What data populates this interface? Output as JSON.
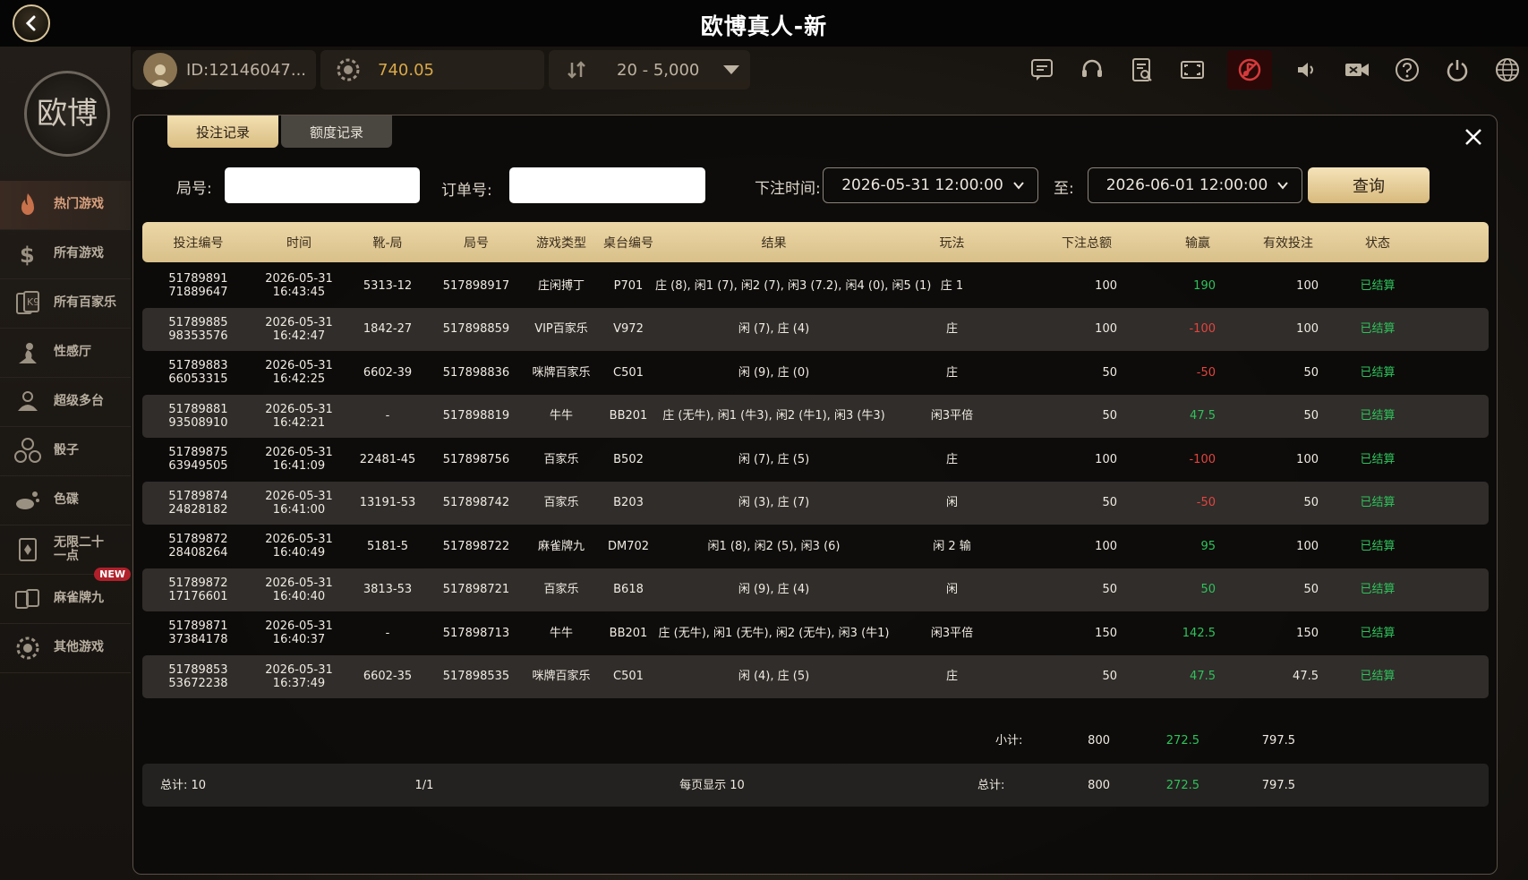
{
  "title": "欧博真人-新",
  "toolbar": {
    "user_id": "ID:12146047...",
    "balance": "740.05",
    "bet_range": "20 - 5,000",
    "icons": [
      "chat-icon",
      "support-icon",
      "history-icon",
      "fullscreen-icon",
      "music-icon",
      "sound-icon",
      "video-icon",
      "help-icon",
      "power-icon",
      "language-icon"
    ]
  },
  "sidebar": {
    "logo_text": "欧博",
    "items": [
      {
        "label": "热门游戏",
        "icon": "flame-icon",
        "active": true
      },
      {
        "label": "所有游戏",
        "icon": "dollar-icon"
      },
      {
        "label": "所有百家乐",
        "icon": "playing-card-icon"
      },
      {
        "label": "性感厅",
        "icon": "lady-icon"
      },
      {
        "label": "超级多台",
        "icon": "multi-table-icon"
      },
      {
        "label": "骰子",
        "icon": "dice-icon"
      },
      {
        "label": "色碟",
        "icon": "dish-icon"
      },
      {
        "label": "无限二十一点",
        "icon": "blackjack-icon"
      },
      {
        "label": "麻雀牌九",
        "icon": "mahjong-icon",
        "badge": "NEW"
      },
      {
        "label": "其他游戏",
        "icon": "chip-icon"
      }
    ]
  },
  "modal": {
    "tabs": [
      "投注记录",
      "额度记录"
    ],
    "filters": {
      "round_label": "局号:",
      "order_label": "订单号:",
      "time_label": "下注时间:",
      "start": "2026-05-31 12:00:00",
      "to_label": "至:",
      "end": "2026-06-01 12:00:00",
      "query_label": "查询"
    },
    "headers": [
      "投注编号",
      "时间",
      "靴-局",
      "局号",
      "游戏类型",
      "桌台编号",
      "结果",
      "玩法",
      "下注总额",
      "输赢",
      "有效投注",
      "状态"
    ],
    "rows": [
      {
        "id1": "51789891",
        "id2": "71889647",
        "date": "2026-05-31",
        "time": "16:43:45",
        "shoe": "5313-12",
        "round": "517898917",
        "type": "庄闲搏丁",
        "table": "P701",
        "result": "庄 (8), 闲1 (7), 闲2 (7), 闲3 (7.2), 闲4 (0), 闲5 (1)",
        "play": "庄 1",
        "bet": "100",
        "win": "190",
        "win_color": "green",
        "valid": "100",
        "status": "已结算"
      },
      {
        "id1": "51789885",
        "id2": "98353576",
        "date": "2026-05-31",
        "time": "16:42:47",
        "shoe": "1842-27",
        "round": "517898859",
        "type": "VIP百家乐",
        "table": "V972",
        "result": "闲 (7), 庄 (4)",
        "play": "庄",
        "bet": "100",
        "win": "-100",
        "win_color": "red",
        "valid": "100",
        "status": "已结算"
      },
      {
        "id1": "51789883",
        "id2": "66053315",
        "date": "2026-05-31",
        "time": "16:42:25",
        "shoe": "6602-39",
        "round": "517898836",
        "type": "咪牌百家乐",
        "table": "C501",
        "result": "闲 (9), 庄 (0)",
        "play": "庄",
        "bet": "50",
        "win": "-50",
        "win_color": "red",
        "valid": "50",
        "status": "已结算"
      },
      {
        "id1": "51789881",
        "id2": "93508910",
        "date": "2026-05-31",
        "time": "16:42:21",
        "shoe": "-",
        "round": "517898819",
        "type": "牛牛",
        "table": "BB201",
        "result": "庄 (无牛), 闲1 (牛3), 闲2 (牛1), 闲3 (牛3)",
        "play": "闲3平倍",
        "bet": "50",
        "win": "47.5",
        "win_color": "green",
        "valid": "50",
        "status": "已结算"
      },
      {
        "id1": "51789875",
        "id2": "63949505",
        "date": "2026-05-31",
        "time": "16:41:09",
        "shoe": "22481-45",
        "round": "517898756",
        "type": "百家乐",
        "table": "B502",
        "result": "闲 (7), 庄 (5)",
        "play": "庄",
        "bet": "100",
        "win": "-100",
        "win_color": "red",
        "valid": "100",
        "status": "已结算"
      },
      {
        "id1": "51789874",
        "id2": "24828182",
        "date": "2026-05-31",
        "time": "16:41:00",
        "shoe": "13191-53",
        "round": "517898742",
        "type": "百家乐",
        "table": "B203",
        "result": "闲 (3), 庄 (7)",
        "play": "闲",
        "bet": "50",
        "win": "-50",
        "win_color": "red",
        "valid": "50",
        "status": "已结算"
      },
      {
        "id1": "51789872",
        "id2": "28408264",
        "date": "2026-05-31",
        "time": "16:40:49",
        "shoe": "5181-5",
        "round": "517898722",
        "type": "麻雀牌九",
        "table": "DM702",
        "result": "闲1 (8), 闲2 (5), 闲3 (6)",
        "play": "闲 2 输",
        "bet": "100",
        "win": "95",
        "win_color": "green",
        "valid": "100",
        "status": "已结算"
      },
      {
        "id1": "51789872",
        "id2": "17176601",
        "date": "2026-05-31",
        "time": "16:40:40",
        "shoe": "3813-53",
        "round": "517898721",
        "type": "百家乐",
        "table": "B618",
        "result": "闲 (9), 庄 (4)",
        "play": "闲",
        "bet": "50",
        "win": "50",
        "win_color": "green",
        "valid": "50",
        "status": "已结算"
      },
      {
        "id1": "51789871",
        "id2": "37384178",
        "date": "2026-05-31",
        "time": "16:40:37",
        "shoe": "-",
        "round": "517898713",
        "type": "牛牛",
        "table": "BB201",
        "result": "庄 (无牛), 闲1 (无牛), 闲2 (无牛), 闲3 (牛1)",
        "play": "闲3平倍",
        "bet": "150",
        "win": "142.5",
        "win_color": "green",
        "valid": "150",
        "status": "已结算"
      },
      {
        "id1": "51789853",
        "id2": "53672238",
        "date": "2026-05-31",
        "time": "16:37:49",
        "shoe": "6602-35",
        "round": "517898535",
        "type": "咪牌百家乐",
        "table": "C501",
        "result": "闲 (4), 庄 (5)",
        "play": "庄",
        "bet": "50",
        "win": "47.5",
        "win_color": "green",
        "valid": "47.5",
        "status": "已结算"
      }
    ],
    "subtotal": {
      "label": "小计:",
      "bet": "800",
      "win": "272.5",
      "valid": "797.5"
    },
    "footer": {
      "total_count": "总计: 10",
      "pages": "1/1",
      "per_page": "每页显示 10",
      "total_label": "总计:",
      "bet": "800",
      "win": "272.5",
      "valid": "797.5"
    }
  }
}
